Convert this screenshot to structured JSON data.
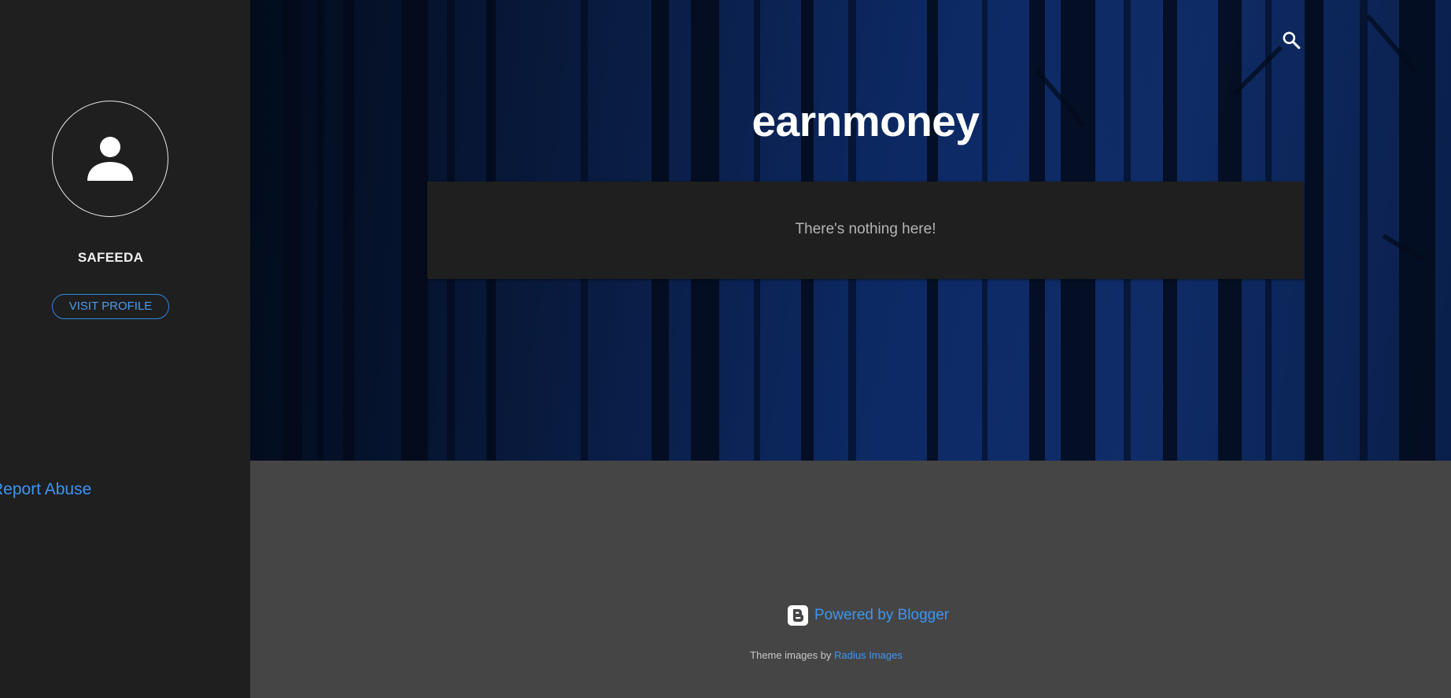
{
  "sidebar": {
    "profile_name": "SAFEEDA",
    "visit_profile_label": "VISIT PROFILE",
    "report_abuse_label": "Report Abuse"
  },
  "header": {
    "blog_title": "earnmoney"
  },
  "main": {
    "empty_message": "There's nothing here!"
  },
  "footer": {
    "powered_by_label": "Powered by Blogger",
    "theme_prefix": "Theme images by",
    "theme_credit_link": "Radius Images"
  },
  "colors": {
    "sidebar_bg": "#1f1f1f",
    "footer_bg": "#454545",
    "card_bg": "#1f1f1f",
    "link_blue": "#3d95f2",
    "hero_blue": "#0d2a66"
  },
  "icons": {
    "search": "search-icon",
    "avatar": "user-avatar-icon",
    "blogger": "blogger-logo-icon"
  }
}
